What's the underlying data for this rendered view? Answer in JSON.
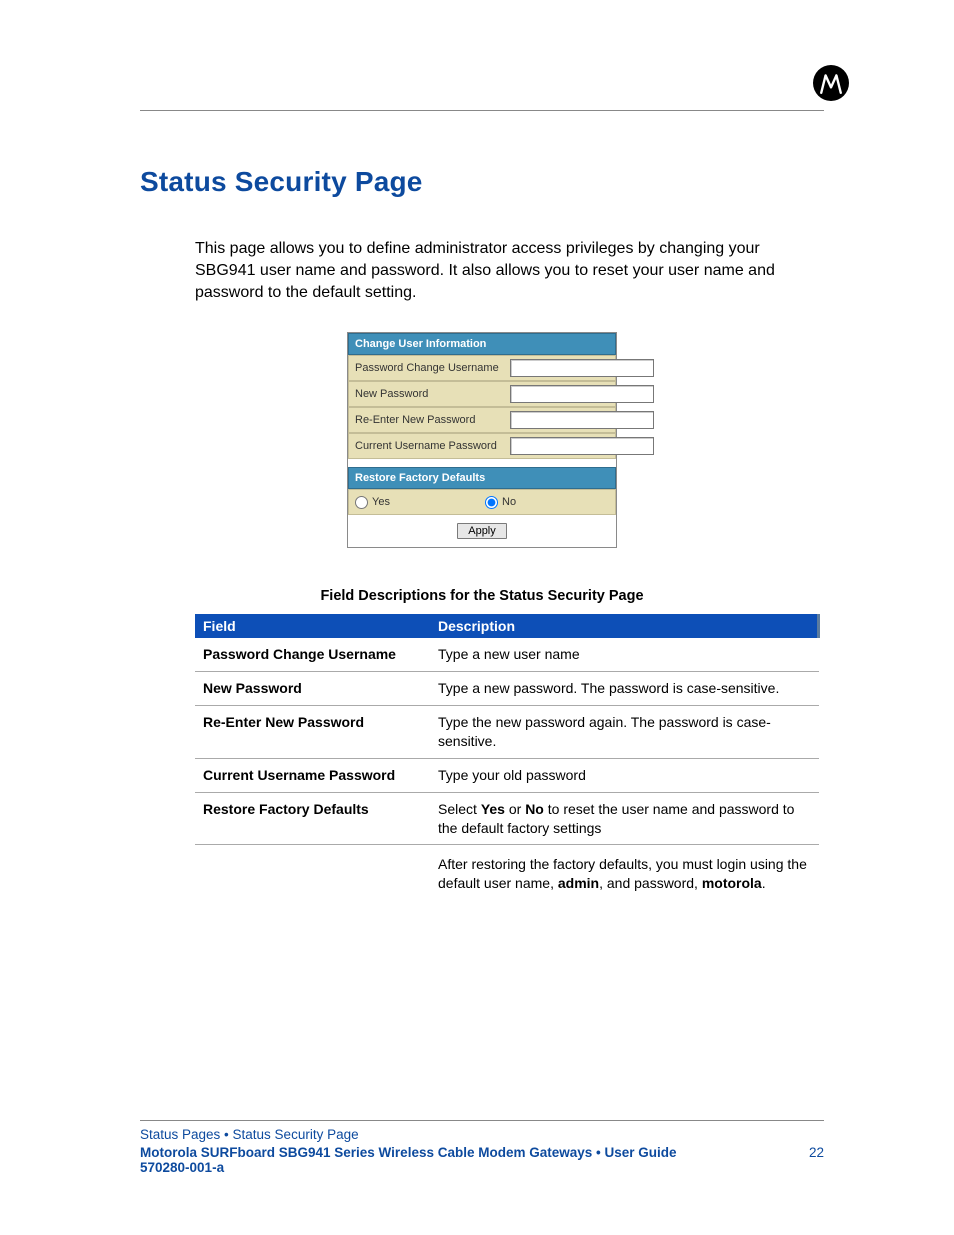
{
  "title": "Status Security Page",
  "intro": "This page allows you to define administrator access privileges by changing your SBG941 user name and password. It also allows you to reset your user name and password to the default setting.",
  "form": {
    "header1": "Change User Information",
    "rows": [
      {
        "label": "Password Change Username",
        "value": ""
      },
      {
        "label": "New Password",
        "value": ""
      },
      {
        "label": "Re-Enter New Password",
        "value": ""
      },
      {
        "label": "Current Username Password",
        "value": ""
      }
    ],
    "header2": "Restore Factory Defaults",
    "radio": {
      "yes": "Yes",
      "no": "No",
      "selected": "No"
    },
    "apply": "Apply"
  },
  "desc_caption": "Field Descriptions for the Status Security Page",
  "desc_table": {
    "col_field": "Field",
    "col_desc": "Description",
    "rows": [
      {
        "field": "Password Change Username",
        "desc": "Type a new user name"
      },
      {
        "field": "New Password",
        "desc": "Type a new password. The password is case-sensitive."
      },
      {
        "field": "Re-Enter New Password",
        "desc": "Type the new password again. The password is case-sensitive."
      },
      {
        "field": "Current Username Password",
        "desc": "Type your old password"
      }
    ],
    "restore": {
      "field": "Restore Factory Defaults",
      "pre1": "Select ",
      "yes": "Yes",
      "mid1": " or ",
      "no": "No",
      "post1": " to reset the user name and password to the default factory settings",
      "pre2": "After restoring the factory defaults, you must login using the default user name, ",
      "admin": "admin",
      "mid2": ", and password, ",
      "motorola": "motorola",
      "post2": "."
    }
  },
  "footer": {
    "breadcrumb": "Status Pages • Status Security Page",
    "docline": "Motorola SURFboard SBG941 Series Wireless Cable Modem Gateways • User Guide",
    "pagenum": "22",
    "docid": "570280-001-a"
  }
}
